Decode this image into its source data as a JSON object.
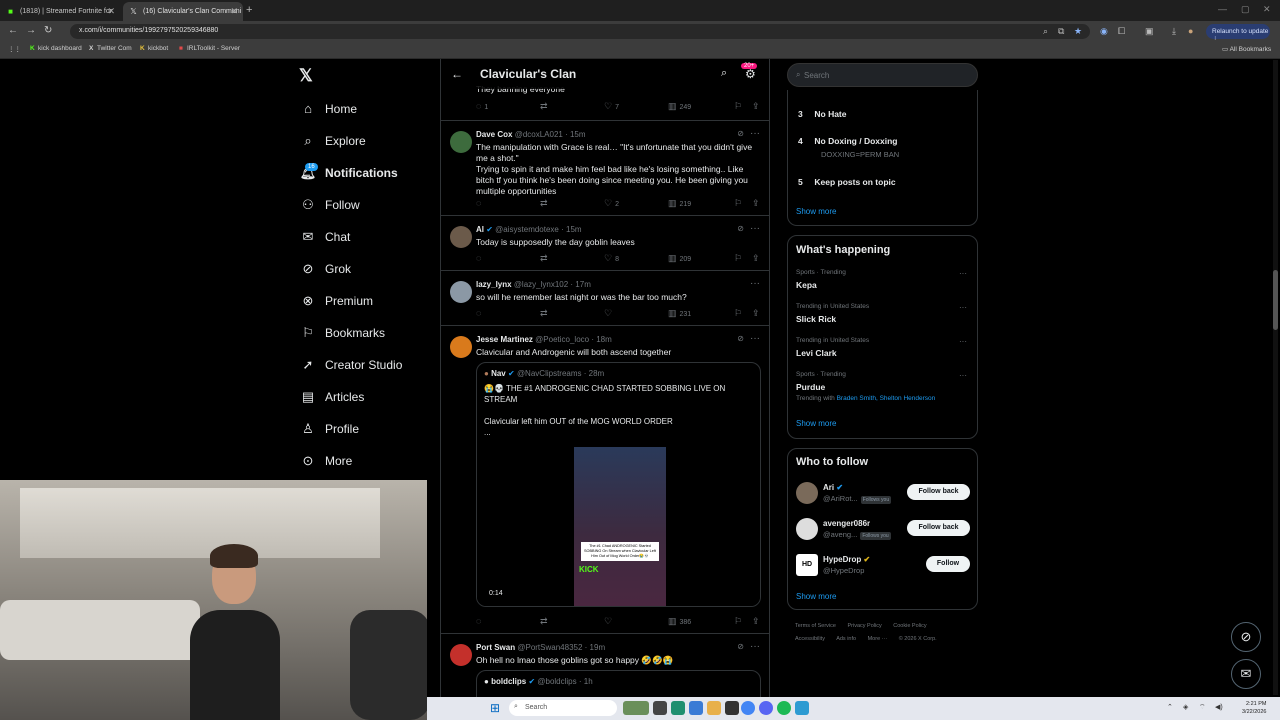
{
  "browser": {
    "tabs": [
      {
        "title": "(1818) | Streamed Fortnite for",
        "active": false
      },
      {
        "title": "(16) Clavicular's Clan Communi",
        "active": true
      }
    ],
    "url": "x.com/i/communities/1992797520259346880",
    "relaunch_label": "Relaunch to update",
    "bookmarks": [
      "kick dashboard",
      "Twitter Com",
      "kickbot",
      "IRLToolkit - Server"
    ],
    "all_bookmarks_label": "All Bookmarks"
  },
  "nav": {
    "items": [
      {
        "label": "Home",
        "icon": "home-icon"
      },
      {
        "label": "Explore",
        "icon": "search-icon"
      },
      {
        "label": "Notifications",
        "icon": "bell-icon"
      },
      {
        "label": "Follow",
        "icon": "person-plus-icon"
      },
      {
        "label": "Chat",
        "icon": "mail-icon"
      },
      {
        "label": "Grok",
        "icon": "grok-icon"
      },
      {
        "label": "Premium",
        "icon": "x-premium-icon"
      },
      {
        "label": "Bookmarks",
        "icon": "bookmark-icon"
      },
      {
        "label": "Creator Studio",
        "icon": "rocket-icon"
      },
      {
        "label": "Articles",
        "icon": "article-icon"
      },
      {
        "label": "Profile",
        "icon": "person-icon"
      },
      {
        "label": "More",
        "icon": "more-circle-icon"
      }
    ],
    "notifications_badge": "16"
  },
  "main": {
    "title": "Clavicular's Clan",
    "header_badge": "20+",
    "tweets": [
      {
        "text": "They banning everyone",
        "replies": "1",
        "likes": "7",
        "views": "249"
      },
      {
        "name": "Dave Cox",
        "handle": "@dcoxLA021",
        "time": "· 15m",
        "text": "The manipulation with Grace is real… \"It's unfortunate that you didn't give me a shot.\"\nTrying to spin it and make him feel bad like he's losing something.. Like bitch tf you think he's been doing since meeting you. He been giving you multiple opportunities",
        "likes": "2",
        "views": "219"
      },
      {
        "name": "Al",
        "handle": "@aisystemdotexe",
        "time": "· 15m",
        "text": "Today is supposedly the day goblin leaves",
        "likes": "8",
        "views": "209"
      },
      {
        "name": "lazy_lynx",
        "handle": "@lazy_lynx102",
        "time": "· 17m",
        "text": "so will he remember last night or was the bar too much?",
        "views": "231"
      },
      {
        "name": "Jesse Martinez",
        "handle": "@Poetico_loco",
        "time": "· 18m",
        "text": "Clavicular and Androgenic will both ascend together",
        "views": "386",
        "quote": {
          "name": "Nav",
          "handle": "@NavClipstreams",
          "time": "· 28m",
          "text": "😭💀 THE #1 ANDROGENIC CHAD STARTED SOBBING LIVE ON STREAM\n\nClavicular left him OUT of the MOG WORLD ORDER\n...",
          "caption": "The #1 Chad ANDROGENIC Started SOBBING On Stream when Clavicular Left Him Out of Mog World Order😭💀",
          "kick_label": "KICK",
          "duration": "0:14"
        }
      },
      {
        "name": "Port Swan",
        "handle": "@PortSwan48352",
        "time": "· 19m",
        "text": "Oh hell no lmao those goblins got so happy 🤣🤣😭",
        "quote": {
          "name": "boldclips",
          "handle": "@boldclips",
          "time": "· 1h"
        }
      }
    ]
  },
  "right": {
    "search_placeholder": "Search",
    "rules": [
      {
        "num": "3",
        "title": "No Hate"
      },
      {
        "num": "4",
        "title": "No Doxing / Doxxing",
        "sub": "DOXXING=PERM BAN"
      },
      {
        "num": "5",
        "title": "Keep posts on topic"
      }
    ],
    "show_more": "Show more",
    "whats_happening": "What's happening",
    "trends": [
      {
        "meta": "Sports · Trending",
        "name": "Kepa"
      },
      {
        "meta": "Trending in United States",
        "name": "Slick Rick"
      },
      {
        "meta": "Trending in United States",
        "name": "Levi Clark"
      },
      {
        "meta": "Sports · Trending",
        "name": "Purdue",
        "with_label": "Trending with",
        "with": "Braden Smith, Shelton Henderson"
      }
    ],
    "who_to_follow": "Who to follow",
    "follow_suggestions": [
      {
        "name": "Ari",
        "handle": "@AriRot...",
        "follows_you": "Follows you",
        "button": "Follow back"
      },
      {
        "name": "avenger086r",
        "handle": "@aveng...",
        "follows_you": "Follows you",
        "button": "Follow back"
      },
      {
        "name": "HypeDrop",
        "handle": "@HypeDrop",
        "button": "Follow"
      }
    ],
    "footer_links": [
      "Terms of Service",
      "Privacy Policy",
      "Cookie Policy",
      "Accessibility",
      "Ads info",
      "More ···",
      "© 2026 X Corp."
    ]
  },
  "taskbar": {
    "search_placeholder": "Search",
    "time": "2:21 PM",
    "date": "3/22/2026"
  }
}
